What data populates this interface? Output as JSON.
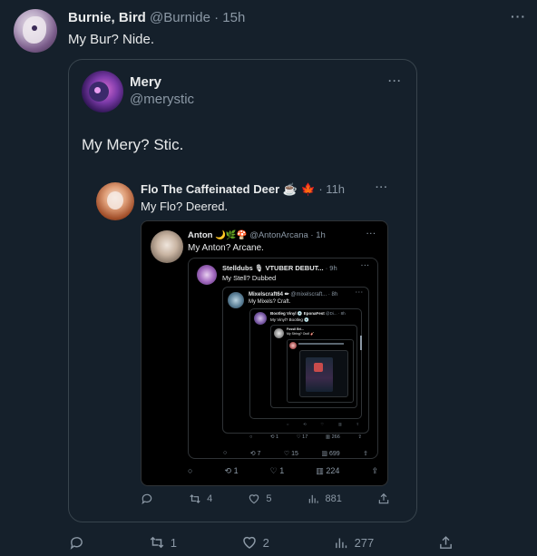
{
  "main_tweet": {
    "author_name": "Burnie, Bird",
    "handle": "@Burnide",
    "time": "· 15h",
    "text": "My Bur? Nide.",
    "more": "···",
    "actions": {
      "reply": "",
      "retweets": "1",
      "likes": "2",
      "views": "277"
    }
  },
  "quote": {
    "author_name": "Mery",
    "handle": "@merystic",
    "more": "···",
    "text": "My Mery? Stic.",
    "actions": {
      "reply": "",
      "retweets": "4",
      "likes": "5",
      "views": "881"
    }
  },
  "nested": {
    "author_name": "Flo The Caffeinated Deer ☕ 🍁",
    "time": "· 11h",
    "text": "My Flo? Deered.",
    "more": "···"
  },
  "screenshot": {
    "l1": {
      "author_name": "Anton 🌙🌿🍄",
      "handle": "@AntonArcana · 1h",
      "text": "My Anton? Arcane.",
      "more": "···",
      "actions": {
        "retweets": "1",
        "likes": "1",
        "views": "224"
      }
    },
    "l2": {
      "author_name": "Stelldubs 🎙 VTUBER DEBUT...",
      "handle": "· 9h",
      "text": "My Stell? Dubbed",
      "more": "···",
      "actions": {
        "retweets": "7",
        "likes": "15",
        "views": "699"
      }
    },
    "l3": {
      "author_name": "Mixelscraft64 ✏",
      "handle": "@mixelscraft... · 8h",
      "text": "My Mixels? Craft.",
      "more": "···",
      "actions": {
        "retweets": "1",
        "likes": "17",
        "views": "266"
      }
    },
    "l4": {
      "author_name": "Bootleg Vinyl 💿 EponaFest",
      "handle": "@Di... · 8h",
      "text": "My Vinyl? Bootleg 💿"
    },
    "l5": {
      "author_name": "Fossil Bri...",
      "text": "My String? Ood! 🎸"
    }
  }
}
